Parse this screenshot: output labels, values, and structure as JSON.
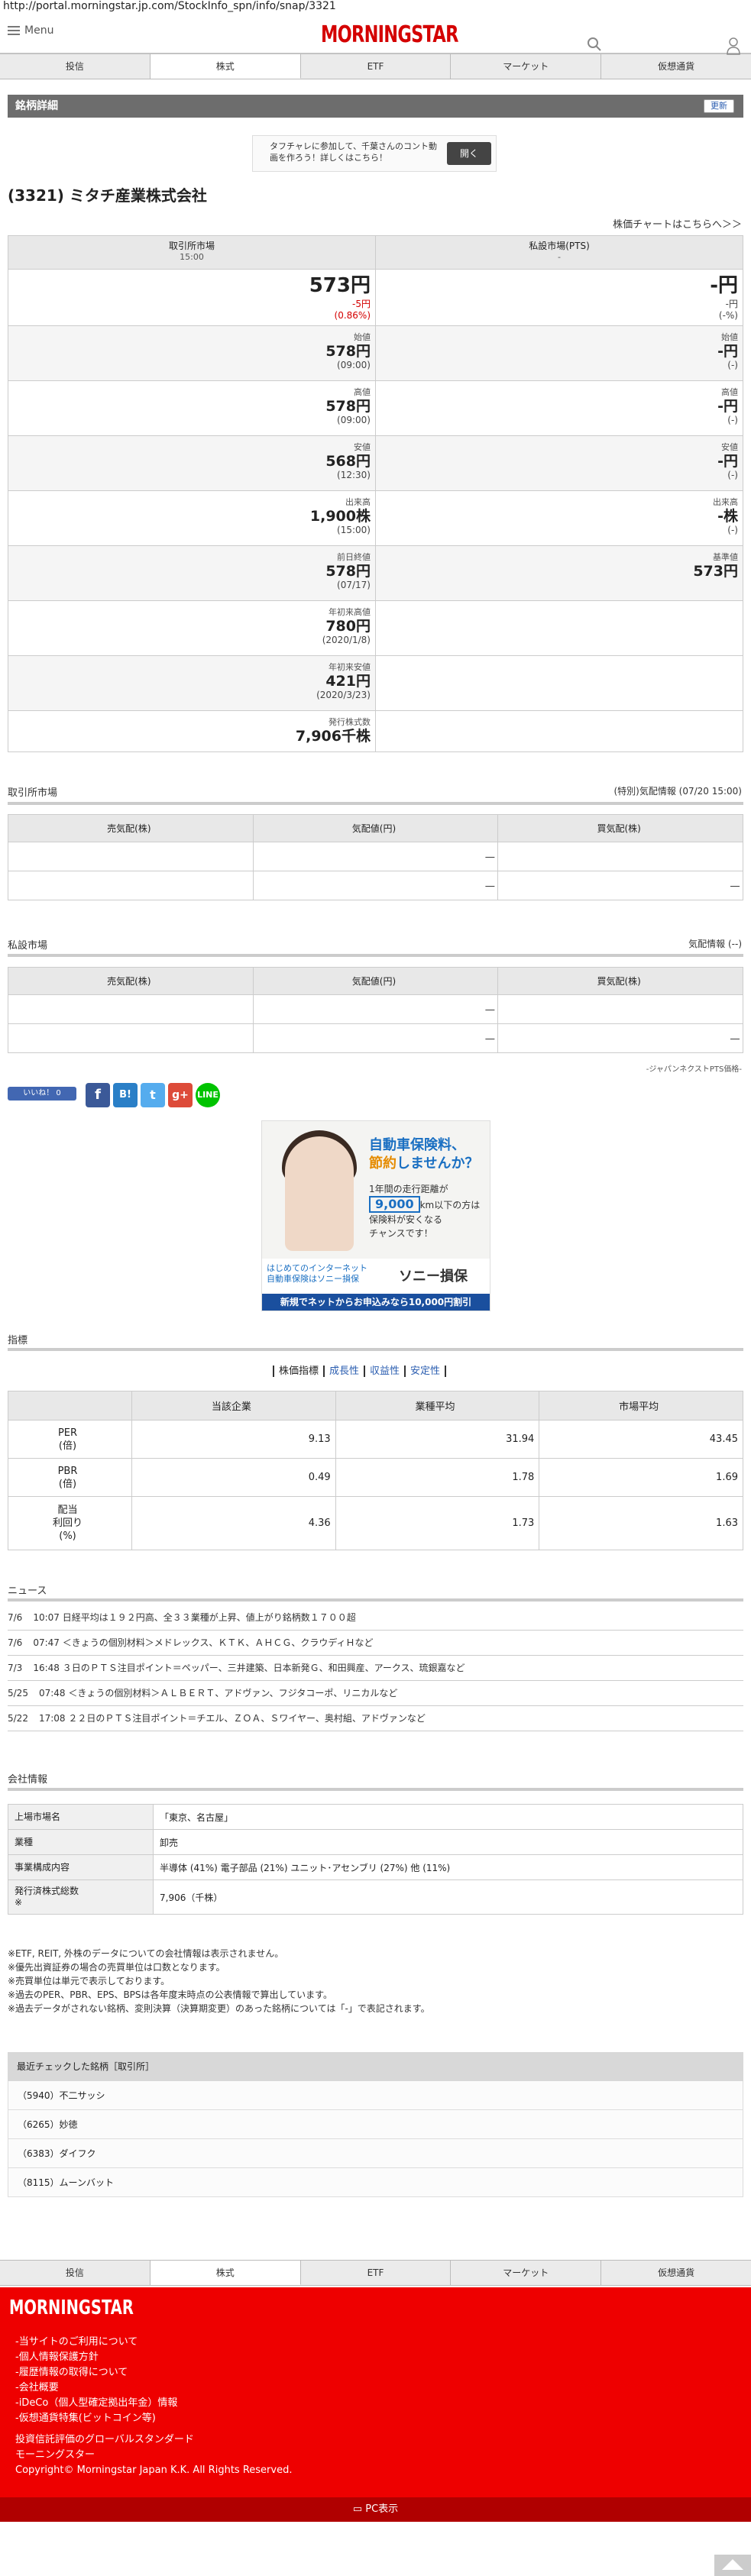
{
  "url": "http://portal.morningstar.jp.com/StockInfo_spn/info/snap/3321",
  "header": {
    "menu_label": "Menu",
    "logo": "MORNINGSTAR"
  },
  "nav_tabs": [
    "投信",
    "株式",
    "ETF",
    "マーケット",
    "仮想通貨"
  ],
  "section_title": "銘柄詳細",
  "refresh_label": "更新",
  "ad1": {
    "text": "タフチャレに参加して、千葉さんのコント動画を作ろう！詳しくはこちら！",
    "button": "開く"
  },
  "stock_title": "(3321) ミタチ産業株式会社",
  "chart_link": "株価チャートはこちらへ＞＞",
  "quote": {
    "left_header": "取引所市場",
    "left_time": "15:00",
    "right_header": "私設市場(PTS)",
    "right_time": "-",
    "price": "573円",
    "change": "-5円",
    "change_pct": "(0.86%)",
    "pts_price": "-円",
    "pts_change": "-円",
    "pts_change_pct": "(-%)",
    "rows": [
      {
        "l_label": "始値",
        "l_val": "578円",
        "l_sub": "(09:00)",
        "r_label": "始値",
        "r_val": "-円",
        "r_sub": "(-)"
      },
      {
        "l_label": "高値",
        "l_val": "578円",
        "l_sub": "(09:00)",
        "r_label": "高値",
        "r_val": "-円",
        "r_sub": "(-)"
      },
      {
        "l_label": "安値",
        "l_val": "568円",
        "l_sub": "(12:30)",
        "r_label": "安値",
        "r_val": "-円",
        "r_sub": "(-)"
      },
      {
        "l_label": "出来高",
        "l_val": "1,900株",
        "l_sub": "(15:00)",
        "r_label": "出来高",
        "r_val": "-株",
        "r_sub": "(-)"
      },
      {
        "l_label": "前日終値",
        "l_val": "578円",
        "l_sub": "(07/17)",
        "r_label": "基準値",
        "r_val": "573円",
        "r_sub": ""
      },
      {
        "l_label": "年初来高値",
        "l_val": "780円",
        "l_sub": "(2020/1/8)",
        "r_label": "",
        "r_val": "",
        "r_sub": ""
      },
      {
        "l_label": "年初来安値",
        "l_val": "421円",
        "l_sub": "(2020/3/23)",
        "r_label": "",
        "r_val": "",
        "r_sub": ""
      },
      {
        "l_label": "発行株式数",
        "l_val": "7,906千株",
        "l_sub": "",
        "r_label": "",
        "r_val": "",
        "r_sub": ""
      }
    ]
  },
  "exchange_board": {
    "title": "取引所市場",
    "info": "(特別)気配情報 (07/20 15:00)",
    "headers": [
      "売気配(株)",
      "気配値(円)",
      "買気配(株)"
    ],
    "rows": [
      [
        "",
        "―",
        ""
      ],
      [
        "",
        "―",
        "―"
      ]
    ]
  },
  "pts_board": {
    "title": "私設市場",
    "info": "気配情報 (--)",
    "headers": [
      "売気配(株)",
      "気配値(円)",
      "買気配(株)"
    ],
    "rows": [
      [
        "",
        "―",
        ""
      ],
      [
        "",
        "―",
        "―"
      ]
    ],
    "note": "-ジャパンネクストPTS価格-"
  },
  "like_label": "いいね！ 0",
  "ad2": {
    "headline1": "自動車保険料、",
    "headline2": "節約",
    "headline3": "しませんか？",
    "body1": "1年間の走行距離が",
    "km": "9,000",
    "body2": "km以下の方は",
    "body3": "保険料が安くなる",
    "body4": "チャンスです！",
    "left_foot": "はじめてのインターネット自動車保険はソニー損保",
    "brand": "ソニー損保",
    "cta": "新規でネットからお申込みなら10,000円割引"
  },
  "indicators": {
    "title": "指標",
    "tabs": [
      "株価指標",
      "成長性",
      "収益性",
      "安定性"
    ],
    "headers": [
      "",
      "当該企業",
      "業種平均",
      "市場平均"
    ],
    "rows": [
      {
        "label1": "PER",
        "label2": "(倍)",
        "vals": [
          "9.13",
          "31.94",
          "43.45"
        ]
      },
      {
        "label1": "PBR",
        "label2": "(倍)",
        "vals": [
          "0.49",
          "1.78",
          "1.69"
        ]
      },
      {
        "label1": "配当",
        "label2": "利回り",
        "label3": "(%)",
        "vals": [
          "4.36",
          "1.73",
          "1.63"
        ]
      }
    ]
  },
  "news": {
    "title": "ニュース",
    "items": [
      {
        "date": "7/6",
        "text": "10:07 日経平均は１９２円高、全３３業種が上昇、値上がり銘柄数１７００超"
      },
      {
        "date": "7/6",
        "text": "07:47 ＜きょうの個別材料＞メドレックス、ＫＴＫ、ＡＨＣＧ、クラウディＨなど"
      },
      {
        "date": "7/3",
        "text": "16:48 ３日のＰＴＳ注目ポイント＝ペッパー、三井建築、日本新発Ｇ、和田興産、アークス、琉銀嘉など"
      },
      {
        "date": "5/25",
        "text": "07:48 ＜きょうの個別材料＞ＡＬＢＥＲＴ、アドヴァン、フジタコーポ、リニカルなど"
      },
      {
        "date": "5/22",
        "text": "17:08 ２２日のＰＴＳ注目ポイント＝チエル、ＺＯＡ、Ｓワイヤー、奥村組、アドヴァンなど"
      }
    ]
  },
  "company": {
    "title": "会社情報",
    "rows": [
      {
        "k": "上場市場名",
        "v": "「東京、名古屋」"
      },
      {
        "k": "業種",
        "v": "卸売"
      },
      {
        "k": "事業構成内容",
        "v": "半導体 (41%) 電子部品 (21%) ユニット･アセンブリ (27%) 他 (11%)"
      },
      {
        "k": "発行済株式総数",
        "k2": "※",
        "v": "7,906（千株）"
      }
    ]
  },
  "notes": [
    "※ETF, REIT, 外株のデータについての会社情報は表示されません。",
    "※優先出資証券の場合の売買単位は口数となります。",
    "※売買単位は単元で表示しております。",
    "※過去のPER、PBR、EPS、BPSは各年度末時点の公表情報で算出しています。",
    "※過去データがされない銘柄、変則決算（決算期変更）のあった銘柄については「-」で表記されます。"
  ],
  "recent": {
    "title": "最近チェックした銘柄［取引所］",
    "items": [
      "（5940）不二サッシ",
      "（6265）妙徳",
      "（6383）ダイフク",
      "（8115）ムーンバット"
    ]
  },
  "footer": {
    "logo": "MORNINGSTAR",
    "links": [
      "-当サイトのご利用について",
      "-個人情報保護方針",
      "-履歴情報の取得について",
      "-会社概要",
      "-iDeCo（個人型確定拠出年金）情報",
      "-仮想通貨特集(ビットコイン等)"
    ],
    "tagline": "投資信託評価のグローバルスタンダード",
    "company": "モーニングスター",
    "copyright": "Copyright© Morningstar Japan K.K. All Rights Reserved."
  },
  "pc_label": "PC表示",
  "colors": {
    "brand_red": "#ee0000",
    "link_blue": "#2a5db0",
    "neg_red": "#d40000"
  }
}
